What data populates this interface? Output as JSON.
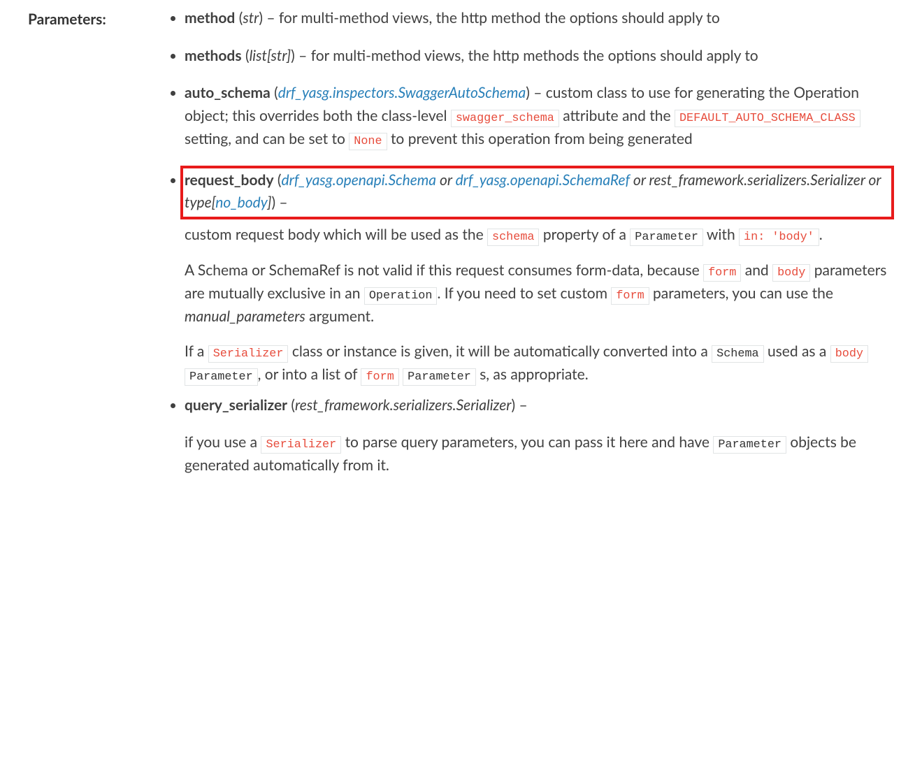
{
  "label": "Parameters:",
  "params": {
    "method": {
      "name": "method",
      "type": "str",
      "desc_prefix": " – ",
      "desc": "for multi-method views, the http method the options should apply to"
    },
    "methods": {
      "name": "methods",
      "type": "list[str]",
      "desc_prefix": " – ",
      "desc": "for multi-method views, the http methods the options should apply to"
    },
    "auto_schema": {
      "name": "auto_schema",
      "type_link": "drf_yasg.inspectors.SwaggerAutoSchema",
      "desc_prefix": " – ",
      "desc1": "custom class to use for generating the Operation object; this overrides both the class-level ",
      "code1": "swagger_schema",
      "desc2": " attribute and the ",
      "code2": "DEFAULT_AUTO_SCHEMA_CLASS",
      "desc3": " setting, and can be set to ",
      "code3": "None",
      "desc4": " to prevent this operation from being generated"
    },
    "request_body": {
      "name": "request_body",
      "type_link1": "drf_yasg.openapi.Schema",
      "or1": " or ",
      "type_link2": "drf_yasg.openapi.SchemaRef",
      "or2": " or ",
      "type_plain": "rest_framework.serializers.Serializer",
      "or3": " or ",
      "type_plain2a": "type[",
      "type_link3": "no_body",
      "type_plain2b": "]",
      "desc_suffix": " – ",
      "p1a": "custom request body which will be used as the ",
      "p1_code1": "schema",
      "p1b": " property of a ",
      "p1_code2": "Parameter",
      "p1c": " with ",
      "p1_code3": "in: 'body'",
      "p1d": ".",
      "p2a": "A Schema or SchemaRef is not valid if this request consumes form-data, because ",
      "p2_code1": "form",
      "p2b": " and ",
      "p2_code2": "body",
      "p2c": " parameters are mutually exclusive in an ",
      "p2_code3": "Operation",
      "p2d": ". If you need to set custom ",
      "p2_code4": "form",
      "p2e": " parameters, you can use the ",
      "p2_em": "manual_parameters",
      "p2f": " argument.",
      "p3a": "If a ",
      "p3_code1": "Serializer",
      "p3b": " class or instance is given, it will be automatically converted into a ",
      "p3_code2": "Schema",
      "p3c": " used as a ",
      "p3_code3": "body",
      "p3_sp": " ",
      "p3_code4": "Parameter",
      "p3d": ", or into a list of ",
      "p3_code5": "form",
      "p3_code6": "Parameter",
      "p3e": " s, as appropriate."
    },
    "query_serializer": {
      "name": "query_serializer",
      "type": "rest_framework.serializers.Serializer",
      "desc_prefix": " – ",
      "p1a": "if you use a ",
      "p1_code1": "Serializer",
      "p1b": " to parse query parameters, you can pass it here and have ",
      "p1_code2": "Parameter",
      "p1c": " objects be generated automatically from it."
    }
  }
}
